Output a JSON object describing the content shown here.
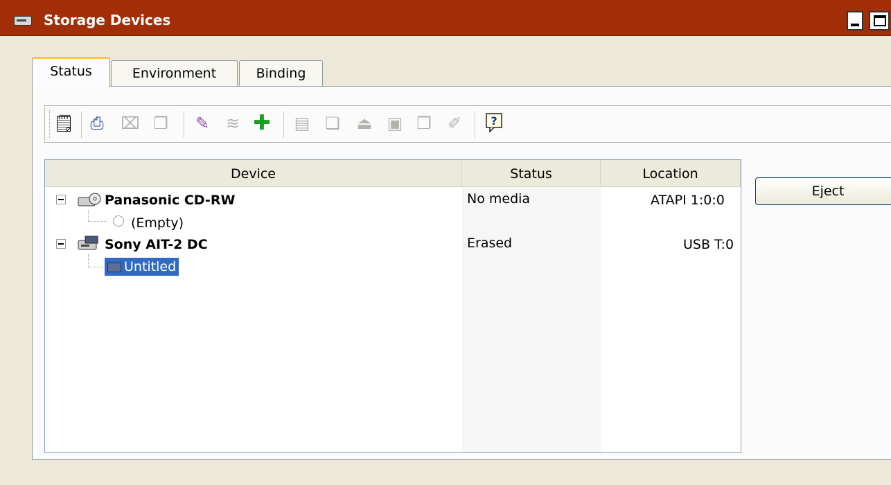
{
  "window": {
    "title": "Storage Devices",
    "icon": "drive-icon"
  },
  "tabs": [
    {
      "label": "Status",
      "selected": true
    },
    {
      "label": "Environment",
      "selected": false
    },
    {
      "label": "Binding",
      "selected": false
    }
  ],
  "toolbar": {
    "buttons": [
      {
        "icon": "properties-icon",
        "enabled": true
      },
      {
        "icon": "drive-select-icon",
        "enabled": true
      },
      {
        "icon": "disconnect-icon",
        "enabled": false
      },
      {
        "icon": "media-copy-icon",
        "enabled": false
      },
      {
        "icon": "erase-icon",
        "enabled": true
      },
      {
        "icon": "wireless-icon",
        "enabled": false
      },
      {
        "icon": "add-icon",
        "enabled": true
      },
      {
        "icon": "catalog-icon",
        "enabled": false
      },
      {
        "icon": "media-info-icon",
        "enabled": false
      },
      {
        "icon": "eject-tray-icon",
        "enabled": false
      },
      {
        "icon": "tape-icon",
        "enabled": false
      },
      {
        "icon": "media-label-icon",
        "enabled": false
      },
      {
        "icon": "media-edit-icon",
        "enabled": false
      },
      {
        "icon": "help-icon",
        "enabled": true
      }
    ]
  },
  "grid": {
    "columns": [
      "Device",
      "Status",
      "Location"
    ],
    "rows": [
      {
        "device": "Panasonic CD-RW",
        "status": "No media",
        "location": "ATAPI 1:0:0",
        "media": "(Empty)"
      },
      {
        "device": "Sony AIT-2 DC",
        "status": "Erased",
        "location": "USB T:0",
        "media": "Untitled"
      }
    ]
  },
  "actions": {
    "eject_label": "Eject"
  },
  "colors": {
    "titlebar": "#a12e06",
    "selection": "#316ac5",
    "tab_highlight": "#ffc83c"
  }
}
